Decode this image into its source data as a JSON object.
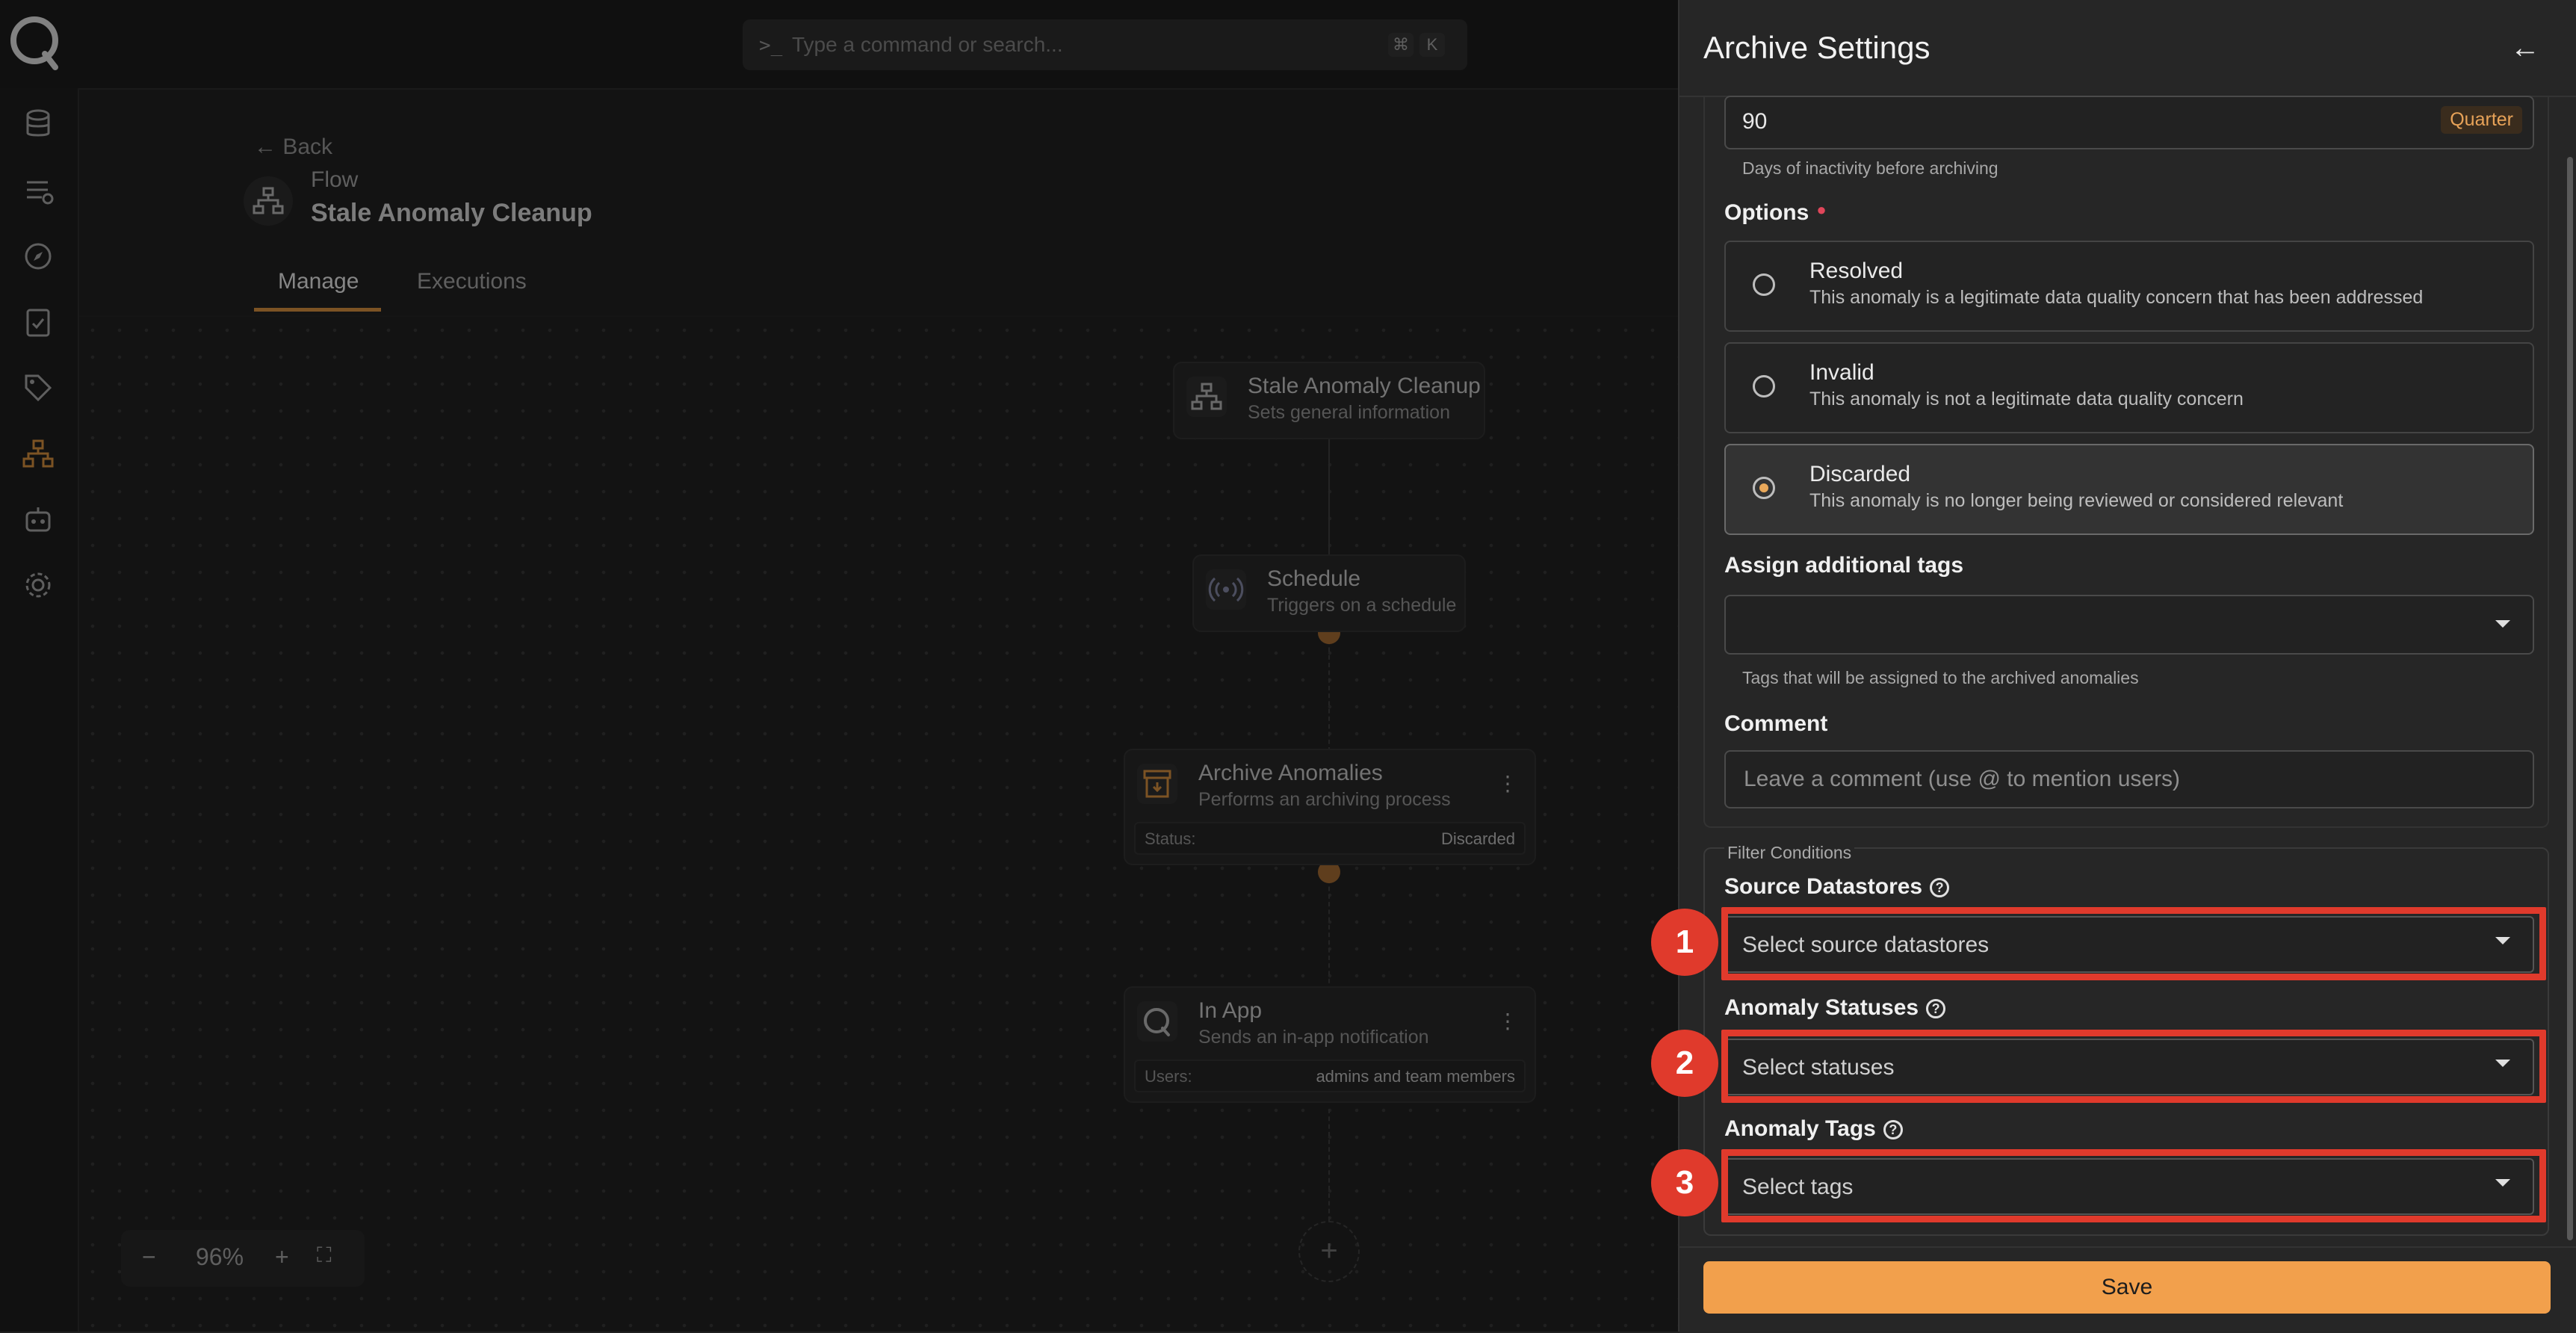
{
  "search": {
    "placeholder": "Type a command or search...",
    "shortcut_keys": [
      "⌘",
      "K"
    ]
  },
  "sidebar": {
    "icons": [
      "database-icon",
      "datastores-icon",
      "explore-icon",
      "checks-icon",
      "tags-icon",
      "flows-icon",
      "agent-icon",
      "settings-icon"
    ]
  },
  "header": {
    "back_label": "Back",
    "type_label": "Flow",
    "title": "Stale Anomaly Cleanup",
    "tabs": [
      "Manage",
      "Executions"
    ]
  },
  "flow_nodes": [
    {
      "title": "Stale Anomaly Cleanup",
      "subtitle": "Sets general information"
    },
    {
      "title": "Schedule",
      "subtitle": "Triggers on a schedule"
    },
    {
      "title": "Archive Anomalies",
      "subtitle": "Performs an archiving process",
      "meta_key": "Status:",
      "meta_value": "Discarded"
    },
    {
      "title": "In App",
      "subtitle": "Sends an in-app notification",
      "meta_key": "Users:",
      "meta_value": "admins and team members"
    }
  ],
  "zoom": {
    "minus": "−",
    "level": "96%",
    "plus": "+"
  },
  "panel": {
    "title": "Archive Settings",
    "days": {
      "value": "90",
      "badge": "Quarter",
      "helper": "Days of inactivity before archiving"
    },
    "options_label": "Options",
    "options": [
      {
        "title": "Resolved",
        "desc": "This anomaly is a legitimate data quality concern that has been addressed",
        "selected": false
      },
      {
        "title": "Invalid",
        "desc": "This anomaly is not a legitimate data quality concern",
        "selected": false
      },
      {
        "title": "Discarded",
        "desc": "This anomaly is no longer being reviewed or considered relevant",
        "selected": true
      }
    ],
    "tags_label": "Assign additional tags",
    "tags_helper": "Tags that will be assigned to the archived anomalies",
    "comment_label": "Comment",
    "comment_placeholder": "Leave a comment (use @ to mention users)",
    "filter_legend": "Filter Conditions",
    "filters": [
      {
        "label": "Source Datastores",
        "placeholder": "Select source datastores",
        "marker": "1"
      },
      {
        "label": "Anomaly Statuses",
        "placeholder": "Select statuses",
        "marker": "2"
      },
      {
        "label": "Anomaly Tags",
        "placeholder": "Select tags",
        "marker": "3"
      }
    ],
    "save_label": "Save"
  },
  "colors": {
    "accent": "#f2a04c",
    "highlight": "#e03a2c",
    "background": "#1f1f1f",
    "panel": "#262626"
  }
}
